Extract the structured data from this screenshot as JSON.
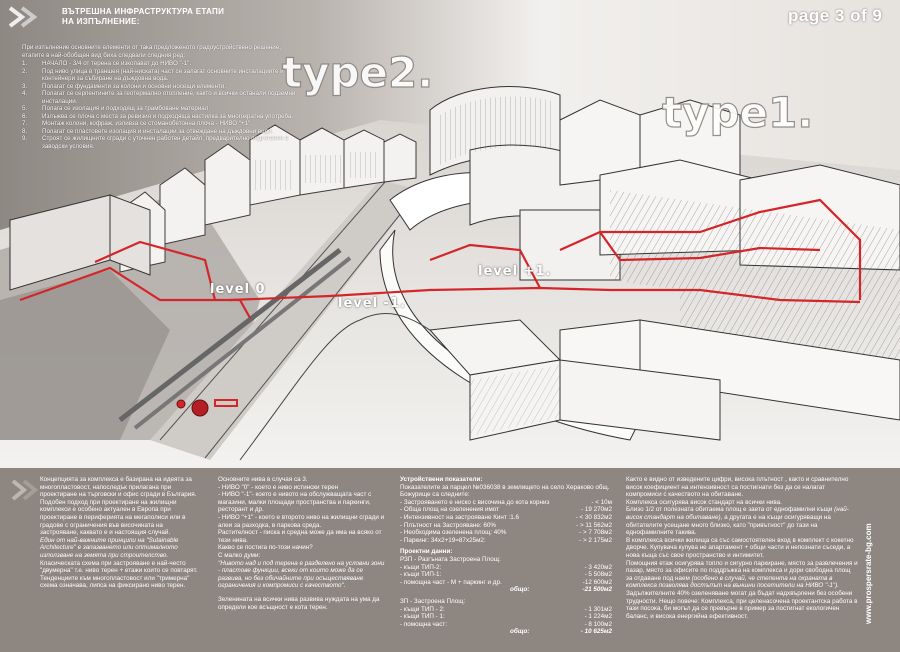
{
  "header": {
    "title_line1": "ВЪТРЕШНА ИНФРАСТРУКТУРА ЕТАПИ",
    "title_line2": "НА ИЗПЪЛНЕНИЕ:",
    "page_label": "page 3 of 9"
  },
  "intro": "При изпълнение основните елементи от така предложеното градоустройствено решение, етапите в най-обобщен вид биха следвали следния ред:",
  "steps": [
    {
      "n": "1.",
      "text": "НАЧАЛО - 3/4 от терена се изкопават до НИВО \"-1\"."
    },
    {
      "n": "2.",
      "text": "Под ниво улица в траншея (най-ниската) част се залагат основните инсталациите и контейнери за събиране на дъждовна вода."
    },
    {
      "n": "3.",
      "text": "Полагат се фундаменти за колони и основни носещи елементи."
    },
    {
      "n": "4.",
      "text": "Полагат се серпентините за геотермално отопление, както и всички останали подземни инсталации."
    },
    {
      "n": "5.",
      "text": "Полага се изолация и подходящ за трамбоване материал."
    },
    {
      "n": "6.",
      "text": "Излъжва се плоча с места за ревизия и подходяща настилка за многократна употреба."
    },
    {
      "n": "7.",
      "text": "Монтаж колони, кофраж, изливза се стоманобетонна плоча - НИВО \"+1\"."
    },
    {
      "n": "8.",
      "text": "Полагат се пластовете изолация и инсталации за отвеждане на дъждовни води."
    },
    {
      "n": "9.",
      "text": "Строят се жилищните сгради с уточнен работен детайл, предварително подготвени в заводски условия."
    }
  ],
  "labels": {
    "type1": "type1.",
    "type2": "type2.",
    "level0": "level 0",
    "level_minus1": "level -1.",
    "level_plus1": "level +1."
  },
  "website": "www.prospersrate-bg.com",
  "col1": {
    "p1": "Концепцията за комплекса е базирана на идеята за многопластовост, напоследък прилагана при проектиране на търговски и офис сгради в България.",
    "p2": "Подобен подход при проектиране на жилищни комплекси е особено актуален в Европа при проектиране в периферията на мегаполиси или в градове с ограничения във височината на застрояване, каквато е и настоящия случай.",
    "p3_lead": "Един от най-важните принципи на ",
    "p3_quote": "\"Sutainable Architecture\" е запазването или оптималното използване на земята при строителство.",
    "p3_rest": " Класическата схема при застрояване е най-често \"двумерна\" т.е. ниво терен + етажи които се повтарят. Тенденциите към многопластовост или \"тримерна\" схема означава, липса на фиксирано ниво терен."
  },
  "col2": {
    "p1": "Основните нива в случая са 3.",
    "p2": "- НИВО \"0\" - което е ниво истински терен",
    "p3": "- НИВО \"-1\"- което е нивото на обслужващата част с магазини, малки площади пространства и паркинги, ресторант и др.",
    "p4": "- НИВО \"+1\" - което е второто ниво на жилищни сгради и алеи за разходка, в паркова среда.",
    "p5": "Растителност - писка и средна може да има на всяко от тези нива.",
    "p6": "Какво се постига по-този начин?",
    "p7": "С малко думи:",
    "p8": "\"Нивото над и под терена е разделено на условни зони - пластове функции, всеки от които може да се развива, но без обичайните при осъществяване ограничения и компромиси с качеството\".",
    "p9": "Зеленината на всички нива развива нуждата на ума да определи кое всъщност е кота терен."
  },
  "col3": {
    "title": "Устройствени показатели:",
    "intro": "Показателите за парцел №036038 в землището на село Хераково общ. Божурище са следните:",
    "rows": [
      {
        "label": "- Застрояването е ниско с височина до кота корниз",
        "value": "- < 10м"
      },
      {
        "label": "- Обща площ на озеленения имот",
        "value": "- 19 270м2"
      },
      {
        "label": "- Интензивност на застрояване Кинт :1.6",
        "value": "- < 30 832м2"
      },
      {
        "label": "- Плътност на Застрояване: 60%",
        "value": "- > 11 562м2"
      },
      {
        "label": "- Необходима озеленена площ: 40%",
        "value": "- > 7 708м2"
      },
      {
        "label": "- Паркинг: 34х2+19=87х25м2:",
        "value": "- > 2 175м2"
      }
    ],
    "proj_title": "Проектни данни:",
    "rzp_title": "РЗП - Разгъната Застроена Площ:",
    "rzp_rows": [
      {
        "label": "- къщи ТИП-2:",
        "value": "- 3 420м2"
      },
      {
        "label": "- къщи ТИП-1:",
        "value": "- 5 508м2"
      },
      {
        "label": "- помощна част - М + паркинг и др.",
        "value": "-12 600м2"
      }
    ],
    "rzp_total_label": "общо:",
    "rzp_total": "-21 500м2",
    "zp_title": "ЗП - Застроена Площ:",
    "zp_rows": [
      {
        "label": "- къщи ТИП - 2:",
        "value": "- 1 301м2"
      },
      {
        "label": "- къщи ТИП - 1:",
        "value": "- 1 224м2"
      },
      {
        "label": "- помощна част:",
        "value": "- 8 100м2"
      }
    ],
    "zp_total_label": "общо:",
    "zp_total": "- 10 625м2"
  },
  "col4": {
    "p1": "Както е видно от изведените цифри, висока плътност , както и сравнително висок коефициент на интензивност са постигнати без да се налагат компромиси с качеството на обитаване.",
    "p2": "Комплекса осигурява висок стандарт на всички нива.",
    "p3_lead": "Близо 1/2 от полезната обитаема площ е заета от еднофамилни къщи ",
    "p3_it": "(най-висок стандарт на обитаване)",
    "p3_rest": ", а другата е на къщи осигуряващи на обитателите усещане много близко, като \"привътност\" до тази на еднофамилните такива.",
    "p4": "В комплекса всички жилища са със самостоятелен вход в комплект с кокетно дворче. Купувача купува не апартамент + общи части и непознати съседи, а нова къща със свое пространство и интимитет.",
    "p5_lead": "Помощния етаж осигурява топло и сигурно паркиране, място за развлечения и пазар, място за офисите по поддръжка на комплекса и дори свободна площ за отдаване под наем ",
    "p5_it": "(особено в случай, че степента на охраната в комплекса позволява достъпът на външни посетители на НИВО \"-1\").",
    "p6": "Задължителните 40% озеленяване могат да бъдат надхвърлени без особени трудности. Нещо повече: Комплекса, при целенасочена проектантска работа в тази посока, би могъл да се превърне в пример за постигнат екологичен баланс, и висока енергийна ефективност."
  },
  "colors": {
    "accent_red": "#d4262a",
    "panel": "#8d8681",
    "text": "#ffffff"
  }
}
